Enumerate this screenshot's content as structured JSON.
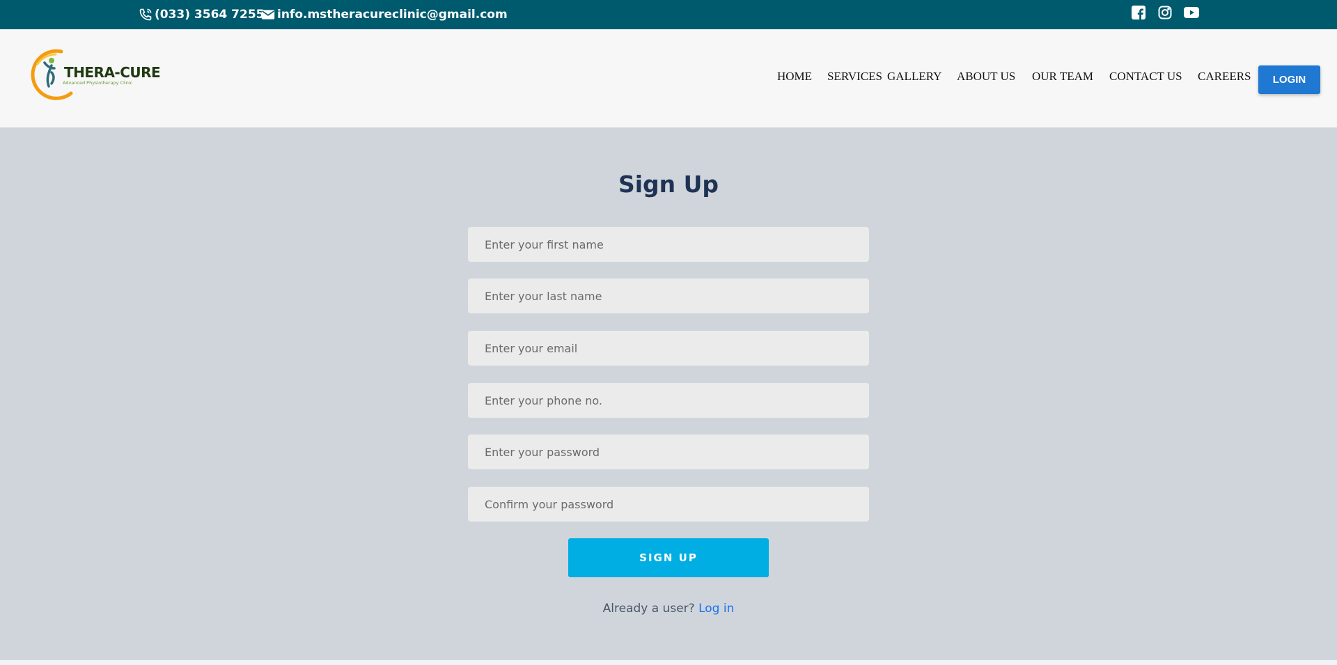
{
  "topbar": {
    "phone": "(033) 3564 7255",
    "email": "info.mstheracureclinic@gmail.com",
    "icons": [
      "phone-icon",
      "mail-icon",
      "facebook-icon",
      "instagram-icon",
      "youtube-icon"
    ]
  },
  "logo": {
    "title": "THERA-CURE",
    "subtitle": "Advanced Physiotherapy Clinic"
  },
  "nav": {
    "items": [
      "HOME",
      "SERVICES",
      "GALLERY",
      "ABOUT US",
      "OUR TEAM",
      "CONTACT US",
      "CAREERS"
    ],
    "login_label": "LOGIN"
  },
  "form": {
    "title": "Sign Up",
    "first_name_placeholder": "Enter your first name",
    "last_name_placeholder": "Enter your last name",
    "email_placeholder": "Enter your email",
    "phone_placeholder": "Enter your phone no.",
    "password_placeholder": "Enter your password",
    "confirm_password_placeholder": "Confirm your password",
    "submit_label": "SIGN UP",
    "already_text": "Already a user?",
    "login_link": "Log in"
  },
  "colors": {
    "topbar_bg": "#005a6e",
    "page_bg": "#d0d5dc",
    "title": "#1e3354",
    "signup_button": "#00aee3",
    "login_button": "#1f78d1",
    "link": "#1a73e8"
  }
}
